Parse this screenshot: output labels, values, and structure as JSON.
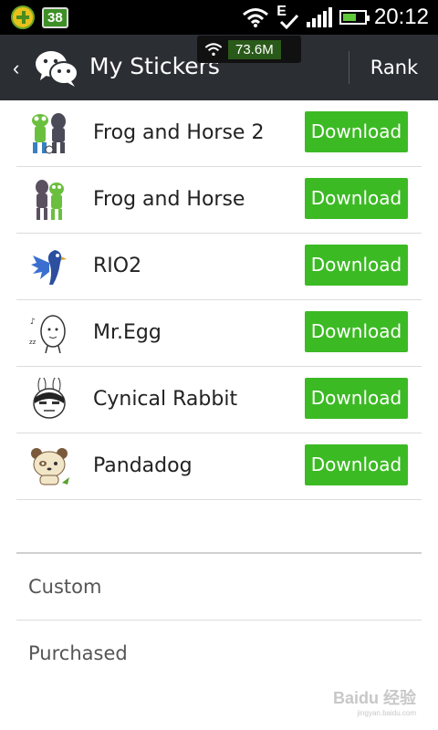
{
  "status_bar": {
    "notification_count": "38",
    "network_type": "E",
    "time": "20:12",
    "battery_level": 0.55
  },
  "network_overlay": {
    "speed": "73.6M"
  },
  "header": {
    "back_icon": "chevron-left-icon",
    "app_icon": "wechat-icon",
    "title": "My Stickers",
    "rank_label": "Rank"
  },
  "stickers": [
    {
      "name": "Frog and Horse 2",
      "button": "Download",
      "icon": "frog-horse-2-icon"
    },
    {
      "name": "Frog and Horse",
      "button": "Download",
      "icon": "frog-horse-icon"
    },
    {
      "name": "RIO2",
      "button": "Download",
      "icon": "rio2-icon"
    },
    {
      "name": "Mr.Egg",
      "button": "Download",
      "icon": "mr-egg-icon"
    },
    {
      "name": "Cynical Rabbit",
      "button": "Download",
      "icon": "cynical-rabbit-icon"
    },
    {
      "name": "Pandadog",
      "button": "Download",
      "icon": "pandadog-icon"
    }
  ],
  "sections": {
    "custom": "Custom",
    "purchased": "Purchased"
  },
  "watermark": {
    "text": "Baidu 经验",
    "sub": "jingyan.baidu.com"
  },
  "colors": {
    "header_bg": "#2b2e33",
    "download_green": "#3cba24",
    "divider": "#dcdcdc"
  }
}
